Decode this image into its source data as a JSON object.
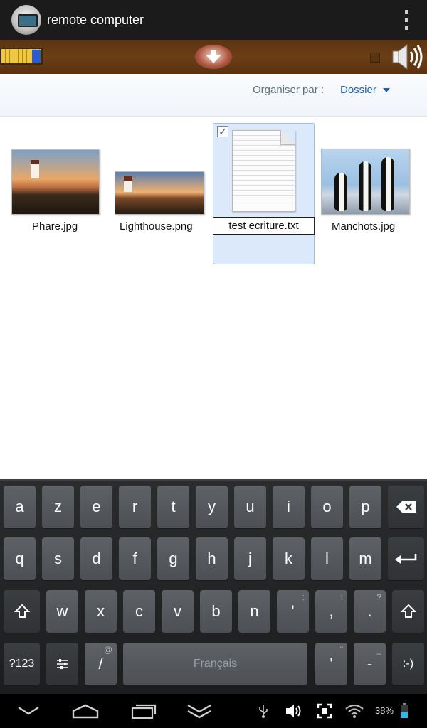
{
  "action_bar": {
    "title": "remote computer"
  },
  "explorer": {
    "organise_label": "Organiser par :",
    "organise_value": "Dossier",
    "files": [
      {
        "name": "Phare.jpg"
      },
      {
        "name": "Lighthouse.png"
      },
      {
        "name": "test ecriture.txt",
        "selected": true,
        "renaming": true
      },
      {
        "name": "Manchots.jpg"
      }
    ]
  },
  "keyboard": {
    "row1": [
      "a",
      "z",
      "e",
      "r",
      "t",
      "y",
      "u",
      "i",
      "o",
      "p"
    ],
    "row2": [
      "q",
      "s",
      "d",
      "f",
      "g",
      "h",
      "j",
      "k",
      "l",
      "m"
    ],
    "row3": [
      "w",
      "x",
      "c",
      "v",
      "b",
      "n",
      "'",
      ",",
      "."
    ],
    "row3_sup": [
      "",
      "",
      "",
      "",
      "",
      "",
      ":",
      "!",
      "?"
    ],
    "symbols_label": "?123",
    "slash_label": "/",
    "slash_sup": "@",
    "space_label": "Français",
    "apostrophe_label": "'",
    "apostrophe_sup": "\"",
    "dash_label": "-",
    "dash_sup": "_",
    "smiley_label": ":-)"
  },
  "status": {
    "battery": "38%"
  }
}
